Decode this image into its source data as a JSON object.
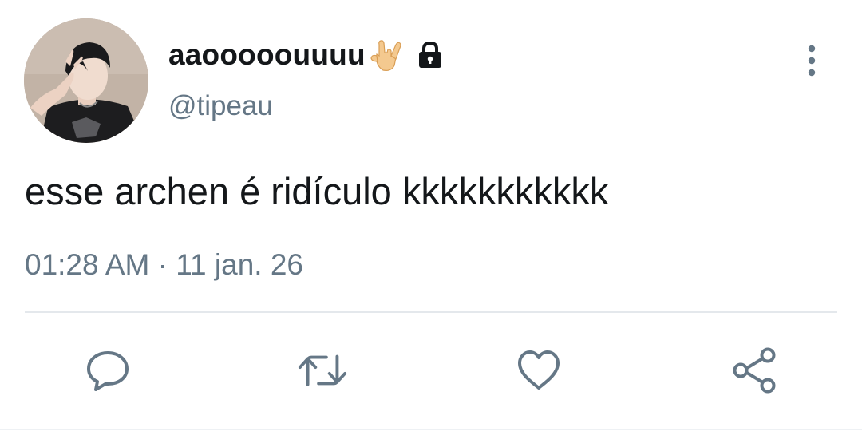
{
  "tweet": {
    "display_name": "aaooooouuuu",
    "handle": "@tipeau",
    "text": "esse archen é ridículo kkkkkkkkkkk",
    "timestamp": "01:28 AM · 11 jan. 26",
    "display_name_emoji": "sign-of-the-horns-emoji",
    "protected_icon": "lock-icon"
  },
  "actions": [
    {
      "name": "reply",
      "icon": "speech-bubble-icon"
    },
    {
      "name": "retweet",
      "icon": "retweet-arrows-icon"
    },
    {
      "name": "like",
      "icon": "heart-icon"
    },
    {
      "name": "share",
      "icon": "share-nodes-icon"
    }
  ],
  "colors": {
    "text": "#14171a",
    "secondary_text": "#657786",
    "icon": "#657786",
    "divider": "#e4e8ec",
    "background": "#ffffff"
  }
}
